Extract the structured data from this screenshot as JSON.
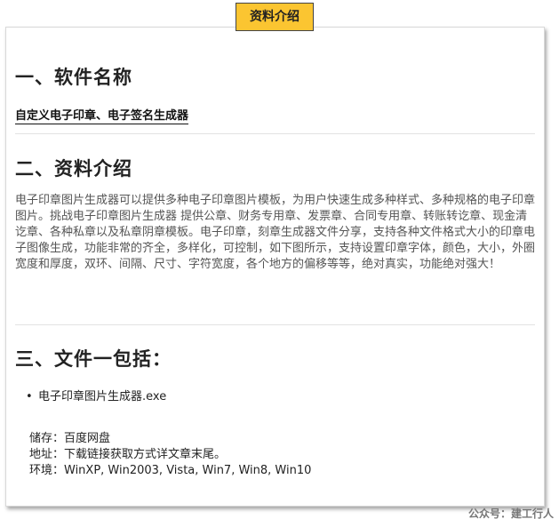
{
  "tab": {
    "label": "资料介绍"
  },
  "sections": {
    "name_title": "一、软件名称",
    "software_name": "自定义电子印章、电子签名生成器",
    "intro_title": "二、资料介绍",
    "intro_text": "电子印章图片生成器可以提供多种电子印章图片模板，为用户快速生成多种样式、多种规格的电子印章图片。挑战电子印章图片生成器 提供公章、财务专用章、发票章、合同专用章、转账转讫章、现金清讫章、各种私章以及私章阴章模板。电子印章，刻章生成器文件分享，支持各种文件格式大小的印章电子图像生成，功能非常的齐全，多样化，可控制，如下图所示，支持设置印章字体，颜色，大小，外圈宽度和厚度，双环、间隔、尺寸、字符宽度，各个地方的偏移等等，绝对真实，功能绝对强大！",
    "files_title": "三、文件一包括：",
    "files": [
      "电子印章图片生成器.exe"
    ]
  },
  "info": {
    "storage": "储存：百度网盘",
    "address": "地址：下载链接获取方式详文章末尾。",
    "environment": "环境：WinXP, Win2003, Vista, Win7, Win8, Win10"
  },
  "watermark": "公众号：建工行人",
  "colors": {
    "tab_background": "#fbc531",
    "heading": "#222222",
    "body_text": "#555555"
  }
}
